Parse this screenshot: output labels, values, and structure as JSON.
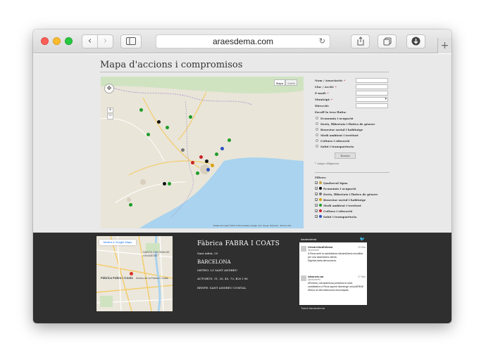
{
  "browser": {
    "url": "araesdema.com",
    "back_icon": "‹",
    "forward_icon": "›",
    "reload_icon": "↻",
    "new_tab_icon": "+"
  },
  "page": {
    "title": "Mapa d'accions i compromisos",
    "map": {
      "map_label": "Mapa",
      "satellite_label": "Satelit",
      "zoom_in": "+",
      "zoom_out": "−",
      "attribution": "Dades del mapa ©2017 GIS Innovatia, Google, Inst. Geogr. Nacional · Termes d'ús"
    },
    "form": {
      "fields": [
        {
          "label": "Nom / Associació:",
          "required": "*"
        },
        {
          "label": "Lloc / Acció:",
          "required": "*"
        },
        {
          "label": "E-mail:",
          "required": "*"
        },
        {
          "label": "Municipi:",
          "required": "*"
        },
        {
          "label": "Direcció:",
          "required": ""
        }
      ],
      "eix_heading": "Escull la teva lluita:",
      "eix_options": [
        "Economia i ocupació",
        "Drets, llibertats i lluites de gènere",
        "Benestar social i habitatge",
        "Medi ambient i territori",
        "Cultura i educació",
        "Salut i transparència"
      ],
      "submit_label": "Enviar",
      "required_note": "* camps obligatoris"
    },
    "filters": {
      "title": "Filtres:",
      "items": [
        {
          "label": "Qualsevol tipus",
          "color": "#c8a13a",
          "check": "✓"
        },
        {
          "label": "Economia i ocupació",
          "color": "#111111",
          "check": "✓"
        },
        {
          "label": "Drets, llibertats i lluites de gènere",
          "color": "#777777",
          "check": "✓"
        },
        {
          "label": "Benestar social i habitatge",
          "color": "#d8a20b",
          "check": "✓"
        },
        {
          "label": "Medi ambient i territori",
          "color": "#1e9c2a",
          "check": "✓"
        },
        {
          "label": "Cultura i educació",
          "color": "#c8232a",
          "check": "✓"
        },
        {
          "label": "Salut i transparència",
          "color": "#2a4fc1",
          "check": "✓"
        }
      ]
    }
  },
  "footer": {
    "minimap": {
      "button": "Mostra a Google Maps",
      "place_label": "Fàbrica Fabra i Coats",
      "nearby_label": "Amics de la Fabra i Coats",
      "district_label": "SANTA COLOMA DE GRAMENET"
    },
    "address": {
      "name": "Fàbrica FABRA I COATS",
      "street": "Sant Adrià, 20",
      "city": "BARCELONA",
      "metro": "METRO: L1 SANT ANDREU",
      "bus": "AUTOBÚS: 11, 35, 40, 73, B20 I 96",
      "renfe": "RENFE: SANT ANDREU COMTAL"
    },
    "twitter": {
      "header": "#araesdemà",
      "bird_icon": "🐦",
      "tweets": [
        {
          "user": "#VendrellAraEsDemà",
          "handle": "@vendrell",
          "date": "29 Mar",
          "text": "A Reus amb la candidatura #AraesDema escollida per una assemblea oberta. Dignitat,drets,democràcia."
        },
        {
          "user": "infoarrels.cat",
          "handle": "@infoarrels",
          "date": "27 Mar",
          "text": "#Política | #AraesDema presenta la seva candidatura a Reus aquest diumenge ow.ly/AREsE #Reus #CAM #eleccions #municipals"
        }
      ],
      "footer": "Tweet #araesdemà"
    }
  }
}
